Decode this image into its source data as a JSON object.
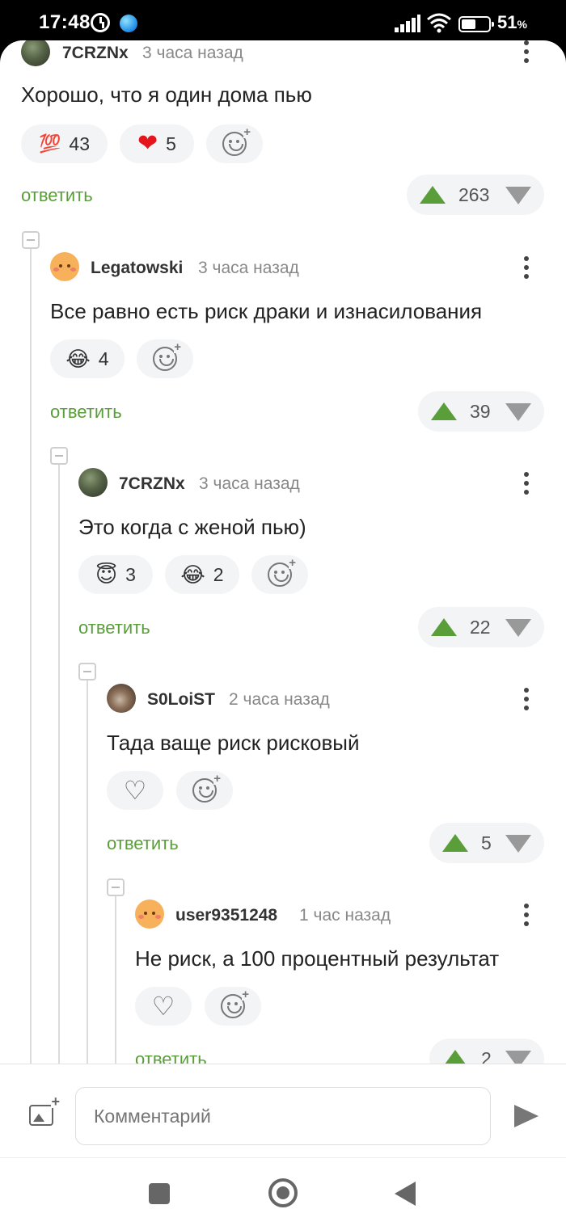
{
  "status_bar": {
    "time": "17:48",
    "battery": "51",
    "battery_unit": "%"
  },
  "reply_label": "ответить",
  "comments": [
    {
      "author": "7CRZNx",
      "time": "3 часа назад",
      "text": "Хорошо, что я один дома пью",
      "reactions": [
        {
          "emoji": "💯",
          "count": "43"
        },
        {
          "emoji": "❤",
          "count": "5"
        }
      ],
      "score": "263"
    },
    {
      "author": "Legatowski",
      "time": "3 часа назад",
      "text": "Все равно есть риск драки и изнасилования",
      "reactions": [
        {
          "emoji": "😂",
          "count": "4"
        }
      ],
      "score": "39"
    },
    {
      "author": "7CRZNx",
      "time": "3 часа назад",
      "text": "Это когда с женой пью)",
      "reactions": [
        {
          "emoji": "😇",
          "count": "3"
        },
        {
          "emoji": "😂",
          "count": "2"
        }
      ],
      "score": "22"
    },
    {
      "author": "S0LoiST",
      "time": "2 часа назад",
      "text": "Тада ваще риск рисковый",
      "reactions": [],
      "score": "5"
    },
    {
      "author": "user9351248",
      "time": "1 час назад",
      "text": "Не риск, а 100 процентный результат",
      "reactions": [],
      "score": "2"
    }
  ],
  "input": {
    "placeholder": "Комментарий"
  },
  "icons": {
    "add_image": "add-image-icon",
    "send": "send-icon",
    "nav": [
      "recents-square-icon",
      "home-circle-icon",
      "back-triangle-icon"
    ]
  },
  "colors": {
    "accent_green": "#5a9e3a",
    "heart_red": "#e5151e",
    "status_bar": "#000000"
  }
}
